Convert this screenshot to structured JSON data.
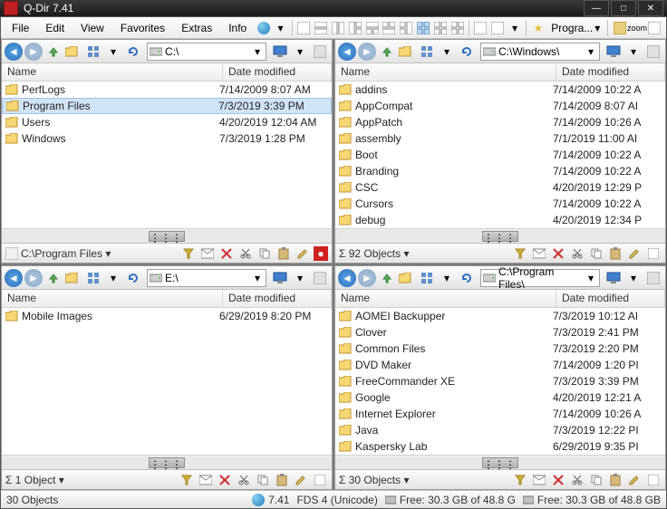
{
  "window": {
    "title": "Q-Dir 7.41"
  },
  "menubar": {
    "items": [
      "File",
      "Edit",
      "View",
      "Favorites",
      "Extras",
      "Info"
    ],
    "progra_label": "Progra..."
  },
  "list_headers": {
    "name": "Name",
    "date": "Date modified"
  },
  "panes": [
    {
      "address": "C:\\",
      "items": [
        {
          "name": "PerfLogs",
          "date": "7/14/2009 8:07 AM"
        },
        {
          "name": "Program Files",
          "date": "7/3/2019 3:39 PM",
          "sel": true
        },
        {
          "name": "Users",
          "date": "4/20/2019 12:04 AM"
        },
        {
          "name": "Windows",
          "date": "7/3/2019 1:28 PM"
        }
      ],
      "status_prefix": "C:\\Program Files"
    },
    {
      "address": "C:\\Windows\\",
      "items": [
        {
          "name": "addins",
          "date": "7/14/2009 10:22 A"
        },
        {
          "name": "AppCompat",
          "date": "7/14/2009 8:07 AI"
        },
        {
          "name": "AppPatch",
          "date": "7/14/2009 10:26 A"
        },
        {
          "name": "assembly",
          "date": "7/1/2019 11:00 AI"
        },
        {
          "name": "Boot",
          "date": "7/14/2009 10:22 A"
        },
        {
          "name": "Branding",
          "date": "7/14/2009 10:22 A"
        },
        {
          "name": "CSC",
          "date": "4/20/2019 12:29 P"
        },
        {
          "name": "Cursors",
          "date": "7/14/2009 10:22 A"
        },
        {
          "name": "debug",
          "date": "4/20/2019 12:34 P"
        }
      ],
      "status_prefix": "Σ 92 Objects"
    },
    {
      "address": "E:\\",
      "items": [
        {
          "name": "Mobile Images",
          "date": "6/29/2019 8:20 PM"
        }
      ],
      "status_prefix": "Σ 1 Object"
    },
    {
      "address": "C:\\Program Files\\",
      "items": [
        {
          "name": "AOMEI Backupper",
          "date": "7/3/2019 10:12 AI"
        },
        {
          "name": "Clover",
          "date": "7/3/2019 2:41 PM"
        },
        {
          "name": "Common Files",
          "date": "7/3/2019 2:20 PM"
        },
        {
          "name": "DVD Maker",
          "date": "7/14/2009 1:20 PI"
        },
        {
          "name": "FreeCommander XE",
          "date": "7/3/2019 3:39 PM"
        },
        {
          "name": "Google",
          "date": "4/20/2019 12:21 A"
        },
        {
          "name": "Internet Explorer",
          "date": "7/14/2009 10:26 A"
        },
        {
          "name": "Java",
          "date": "7/3/2019 12:22 PI"
        },
        {
          "name": "Kaspersky Lab",
          "date": "6/29/2019 9:35 PI"
        }
      ],
      "status_prefix": "Σ 30 Objects"
    }
  ],
  "statusbar": {
    "objects": "30 Objects",
    "version": "7.41",
    "encoding": "FDS 4 (Unicode)",
    "free1": "Free: 30.3 GB of 48.8 G",
    "free2": "Free: 30.3 GB of 48.8 GB"
  }
}
